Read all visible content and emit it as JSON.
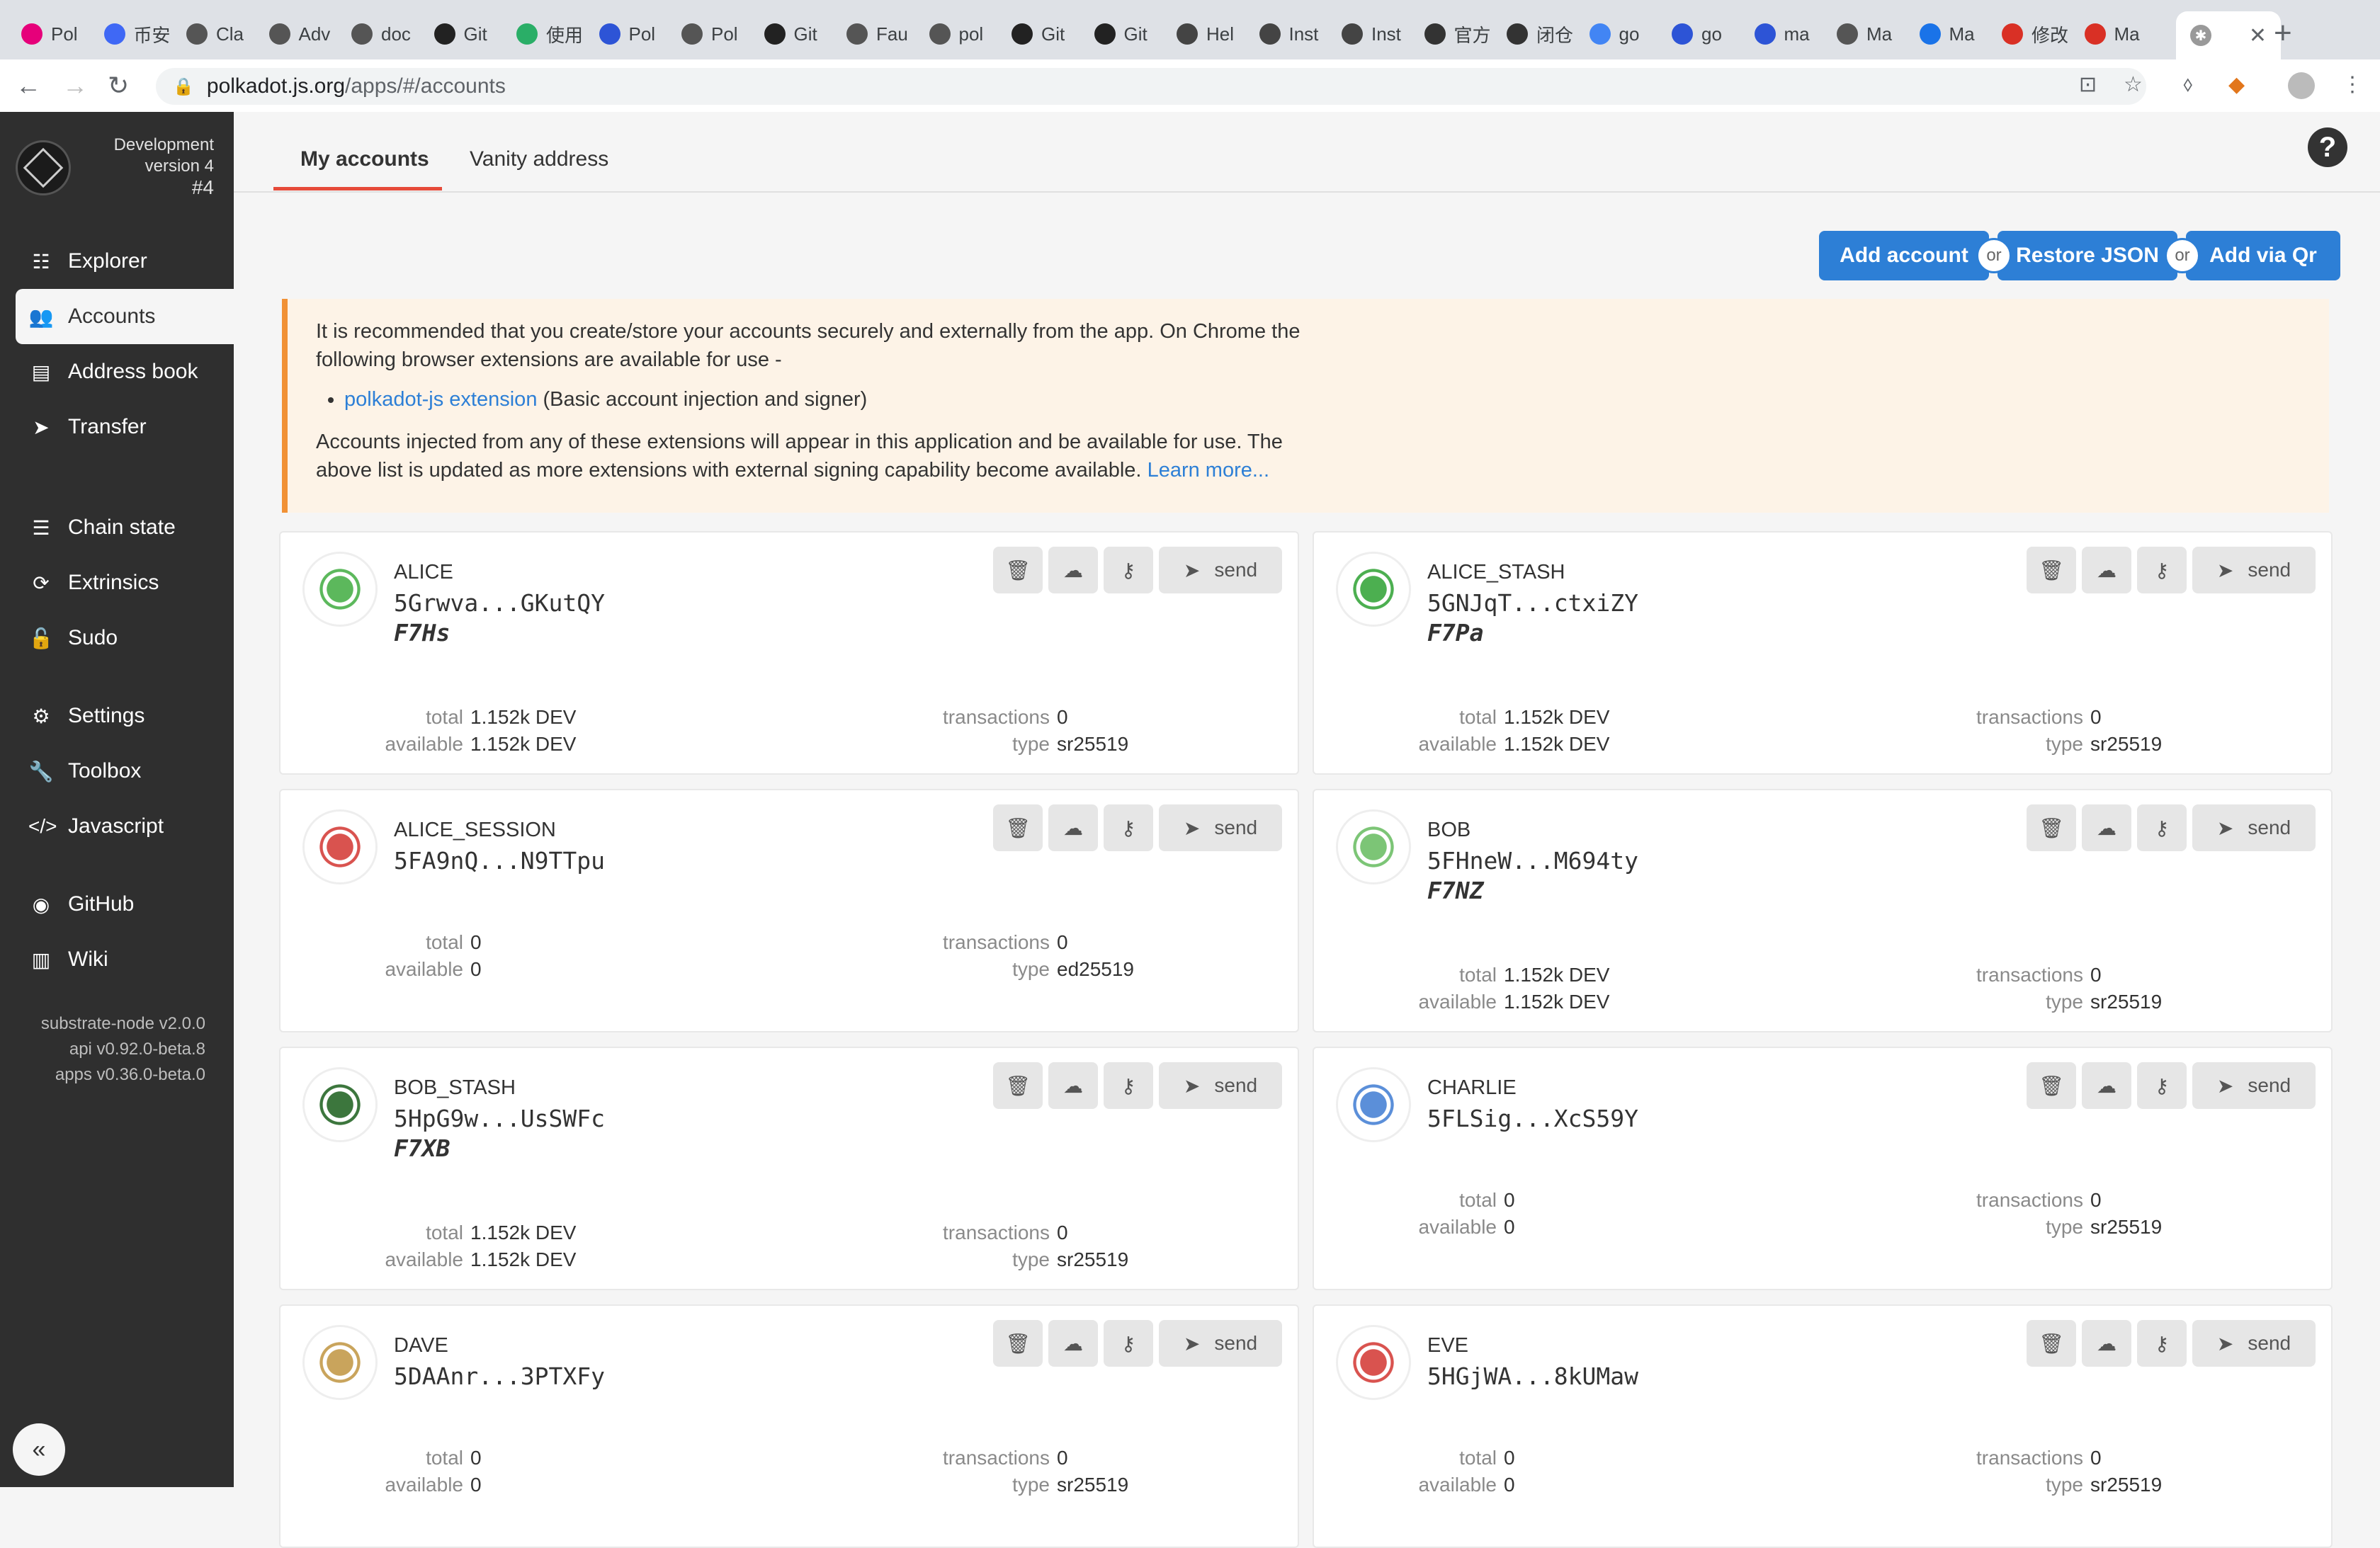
{
  "browser": {
    "tabs": [
      {
        "label": "Pol",
        "color": "#e6007a"
      },
      {
        "label": "币安",
        "color": "#3f68f5"
      },
      {
        "label": "Cla",
        "color": "#555"
      },
      {
        "label": "Adv",
        "color": "#555"
      },
      {
        "label": "doc",
        "color": "#555"
      },
      {
        "label": "Git",
        "color": "#222"
      },
      {
        "label": "使用",
        "color": "#2aae67"
      },
      {
        "label": "Pol",
        "color": "#2d54d6"
      },
      {
        "label": "Pol",
        "color": "#555"
      },
      {
        "label": "Git",
        "color": "#222"
      },
      {
        "label": "Fau",
        "color": "#555"
      },
      {
        "label": "pol",
        "color": "#555"
      },
      {
        "label": "Git",
        "color": "#222"
      },
      {
        "label": "Git",
        "color": "#222"
      },
      {
        "label": "Hel",
        "color": "#444"
      },
      {
        "label": "Inst",
        "color": "#444"
      },
      {
        "label": "Inst",
        "color": "#444"
      },
      {
        "label": "官方",
        "color": "#333"
      },
      {
        "label": "闭仓",
        "color": "#333"
      },
      {
        "label": "go",
        "color": "#4285f4"
      },
      {
        "label": "go",
        "color": "#2d54d6"
      },
      {
        "label": "ma",
        "color": "#2d54d6"
      },
      {
        "label": "Ma",
        "color": "#555"
      },
      {
        "label": "Ma",
        "color": "#1a73e8"
      },
      {
        "label": "修改",
        "color": "#d93025"
      },
      {
        "label": "Ma",
        "color": "#d93025"
      }
    ],
    "url_host": "polkadot.js.org",
    "url_path": "/apps/#/accounts"
  },
  "sidebar": {
    "chain_title": "Development",
    "chain_version": "version 4",
    "chain_block": "#4",
    "items": [
      {
        "label": "Explorer",
        "icon": "explorer-icon",
        "glyph": "☷"
      },
      {
        "label": "Accounts",
        "icon": "users-icon",
        "glyph": "👥"
      },
      {
        "label": "Address book",
        "icon": "address-book-icon",
        "glyph": "▤"
      },
      {
        "label": "Transfer",
        "icon": "paper-plane-icon",
        "glyph": "➤"
      },
      {
        "label": "Chain state",
        "icon": "database-icon",
        "glyph": "☰"
      },
      {
        "label": "Extrinsics",
        "icon": "sync-icon",
        "glyph": "⟳"
      },
      {
        "label": "Sudo",
        "icon": "unlock-icon",
        "glyph": "🔓"
      },
      {
        "label": "Settings",
        "icon": "settings-icon",
        "glyph": "⚙"
      },
      {
        "label": "Toolbox",
        "icon": "wrench-icon",
        "glyph": "🔧"
      },
      {
        "label": "Javascript",
        "icon": "code-icon",
        "glyph": "</>"
      },
      {
        "label": "GitHub",
        "icon": "github-icon",
        "glyph": "◉"
      },
      {
        "label": "Wiki",
        "icon": "book-icon",
        "glyph": "▥"
      }
    ],
    "versions": [
      "substrate-node v2.0.0",
      "api v0.92.0-beta.8",
      "apps v0.36.0-beta.0"
    ]
  },
  "topnav": {
    "tabs": [
      "My accounts",
      "Vanity address"
    ],
    "active": "My accounts"
  },
  "actions": {
    "add_account": "Add account",
    "or": "or",
    "restore_json": "Restore JSON",
    "add_via_qr": "Add via Qr"
  },
  "notice": {
    "p1": "It is recommended that you create/store your accounts securely and externally from the app. On Chrome the following browser extensions are available for use -",
    "link": "polkadot-js extension",
    "link_desc": "(Basic account injection and signer)",
    "p2": "Accounts injected from any of these extensions will appear in this application and be available for use. The above list is updated as more extensions with external signing capability become available.",
    "learn_more": "Learn more..."
  },
  "labels": {
    "total": "total",
    "available": "available",
    "transactions": "transactions",
    "type": "type",
    "send": "send"
  },
  "accounts": [
    {
      "name": "ALICE",
      "address": "5Grwva...GKutQY",
      "suffix": "F7Hs",
      "total": "1.152k DEV",
      "available": "1.152k DEV",
      "transactions": "0",
      "type": "sr25519",
      "color": "#5cb85c"
    },
    {
      "name": "ALICE_STASH",
      "address": "5GNJqT...ctxiZY",
      "suffix": "F7Pa",
      "total": "1.152k DEV",
      "available": "1.152k DEV",
      "transactions": "0",
      "type": "sr25519",
      "color": "#4caf50"
    },
    {
      "name": "ALICE_SESSION",
      "address": "5FA9nQ...N9TTpu",
      "suffix": "",
      "total": "0",
      "available": "0",
      "transactions": "0",
      "type": "ed25519",
      "color": "#d9534f"
    },
    {
      "name": "BOB",
      "address": "5FHneW...M694ty",
      "suffix": "F7NZ",
      "total": "1.152k DEV",
      "available": "1.152k DEV",
      "transactions": "0",
      "type": "sr25519",
      "color": "#7cc576"
    },
    {
      "name": "BOB_STASH",
      "address": "5HpG9w...UsSWFc",
      "suffix": "F7XB",
      "total": "1.152k DEV",
      "available": "1.152k DEV",
      "transactions": "0",
      "type": "sr25519",
      "color": "#3c763d"
    },
    {
      "name": "CHARLIE",
      "address": "5FLSig...XcS59Y",
      "suffix": "",
      "total": "0",
      "available": "0",
      "transactions": "0",
      "type": "sr25519",
      "color": "#5b8fd9"
    },
    {
      "name": "DAVE",
      "address": "5DAAnr...3PTXFy",
      "suffix": "",
      "total": "0",
      "available": "0",
      "transactions": "0",
      "type": "sr25519",
      "color": "#c9a45c"
    },
    {
      "name": "EVE",
      "address": "5HGjWA...8kUMaw",
      "suffix": "",
      "total": "0",
      "available": "0",
      "transactions": "0",
      "type": "sr25519",
      "color": "#d9534f"
    }
  ]
}
